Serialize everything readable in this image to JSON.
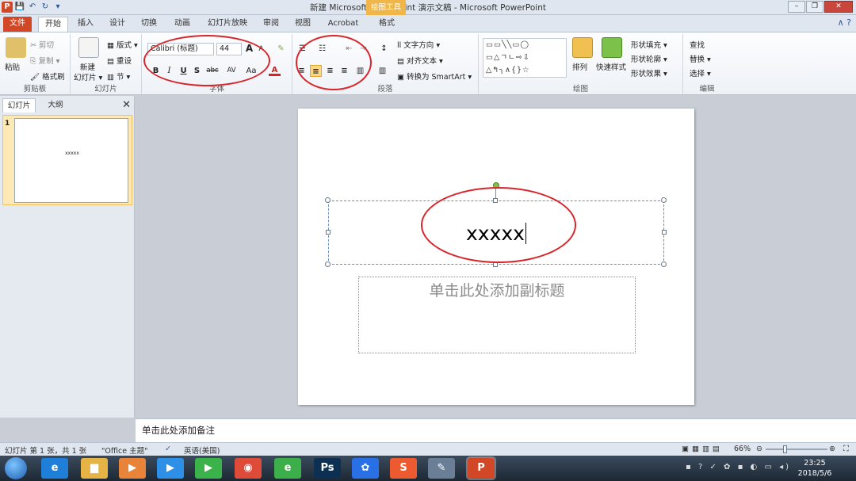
{
  "titlebar": {
    "title": "新建 Microsoft PowerPoint 演示文稿 - Microsoft PowerPoint",
    "context_tab": "绘图工具",
    "qat": {
      "app": "P",
      "save": "💾",
      "undo": "↶",
      "redo": "↻",
      "more": "▾"
    },
    "controls": {
      "minimize": "–",
      "maximize": "❐",
      "close": "✕"
    }
  },
  "tabs": [
    {
      "label": "文件"
    },
    {
      "label": "开始"
    },
    {
      "label": "插入"
    },
    {
      "label": "设计"
    },
    {
      "label": "切换"
    },
    {
      "label": "动画"
    },
    {
      "label": "幻灯片放映"
    },
    {
      "label": "审阅"
    },
    {
      "label": "视图"
    },
    {
      "label": "Acrobat"
    },
    {
      "label": "格式"
    }
  ],
  "tabs_right": "∧ ?",
  "ribbon": {
    "clipboard": {
      "label": "剪贴板",
      "paste": "粘贴",
      "cut": "✂ 剪切",
      "copy": "⎘ 复制 ▾",
      "format_painter": "🖌 格式刷"
    },
    "slides": {
      "label": "幻灯片",
      "new_slide": "新建",
      "new_slide2": "幻灯片 ▾",
      "layout": "▦ 版式 ▾",
      "reset": "▤ 重设",
      "section": "▥ 节 ▾"
    },
    "font": {
      "label": "字体",
      "font_name": "Calibri (标题)",
      "font_size": "44",
      "grow": "A",
      "shrink": "A",
      "clear": "✎",
      "bold": "B",
      "italic": "I",
      "underline": "U",
      "shadow": "S",
      "strike": "abc",
      "spacing": "AV",
      "case": "Aa",
      "color": "A"
    },
    "paragraph": {
      "label": "段落",
      "bullets": "☰",
      "numbering": "☷",
      "dec_indent": "⇤",
      "inc_indent": "⇥",
      "line_spacing": "↕",
      "align_left": "≡",
      "align_center": "≡",
      "align_right": "≡",
      "justify": "≡",
      "columns": "▥",
      "text_direction": "ll 文字方向 ▾",
      "align_text": "▤ 对齐文本 ▾",
      "smartart": "▣ 转换为 SmartArt ▾"
    },
    "drawing": {
      "label": "绘图",
      "shapes_row1": "▭▭╲╲▭◯",
      "shapes_row2": "▭△ㄱㄴ⇨⇩",
      "shapes_row3": "△↰╮∧{}☆",
      "arrange": "排列",
      "quick_styles": "快速样式",
      "shape_fill": "形状填充 ▾",
      "shape_outline": "形状轮廓 ▾",
      "shape_effects": "形状效果 ▾"
    },
    "editing": {
      "label": "编辑",
      "find": "查找",
      "replace": "替换 ▾",
      "select": "选择 ▾"
    }
  },
  "panel": {
    "tabs": [
      "幻灯片",
      "大纲"
    ],
    "close": "✕",
    "slides": [
      {
        "number": "1",
        "text": "xxxxx"
      }
    ]
  },
  "slide": {
    "title_text": "xxxxx",
    "subtitle_placeholder": "单击此处添加副标题"
  },
  "notes": {
    "placeholder": "单击此处添加备注"
  },
  "status": {
    "slide_info": "幻灯片 第 1 张，共 1 张",
    "theme": "\"Office 主题\"",
    "language": "英语(美国)",
    "zoom": "66%",
    "zoom_minus": "⊖",
    "zoom_plus": "⊕"
  },
  "taskbar": {
    "apps": [
      {
        "name": "ie",
        "glyph": "e",
        "color": "#1f7fd8"
      },
      {
        "name": "explorer",
        "glyph": "▆",
        "color": "#e6b445"
      },
      {
        "name": "video",
        "glyph": "▶",
        "color": "#e8833a"
      },
      {
        "name": "player",
        "glyph": "▶",
        "color": "#2d8fe6"
      },
      {
        "name": "player2",
        "glyph": "▶",
        "color": "#3cb34a"
      },
      {
        "name": "chrome",
        "glyph": "◉",
        "color": "#de4b39"
      },
      {
        "name": "browser",
        "glyph": "e",
        "color": "#3cae4a"
      },
      {
        "name": "photoshop",
        "glyph": "Ps",
        "color": "#0c2f52"
      },
      {
        "name": "baidu",
        "glyph": "✿",
        "color": "#2970e6"
      },
      {
        "name": "sogou",
        "glyph": "S",
        "color": "#ee5a2f"
      },
      {
        "name": "paint",
        "glyph": "✎",
        "color": "#6a7f96"
      },
      {
        "name": "powerpoint",
        "glyph": "P",
        "color": "#d24726"
      }
    ],
    "time": "23:25",
    "date": "2018/5/6"
  }
}
